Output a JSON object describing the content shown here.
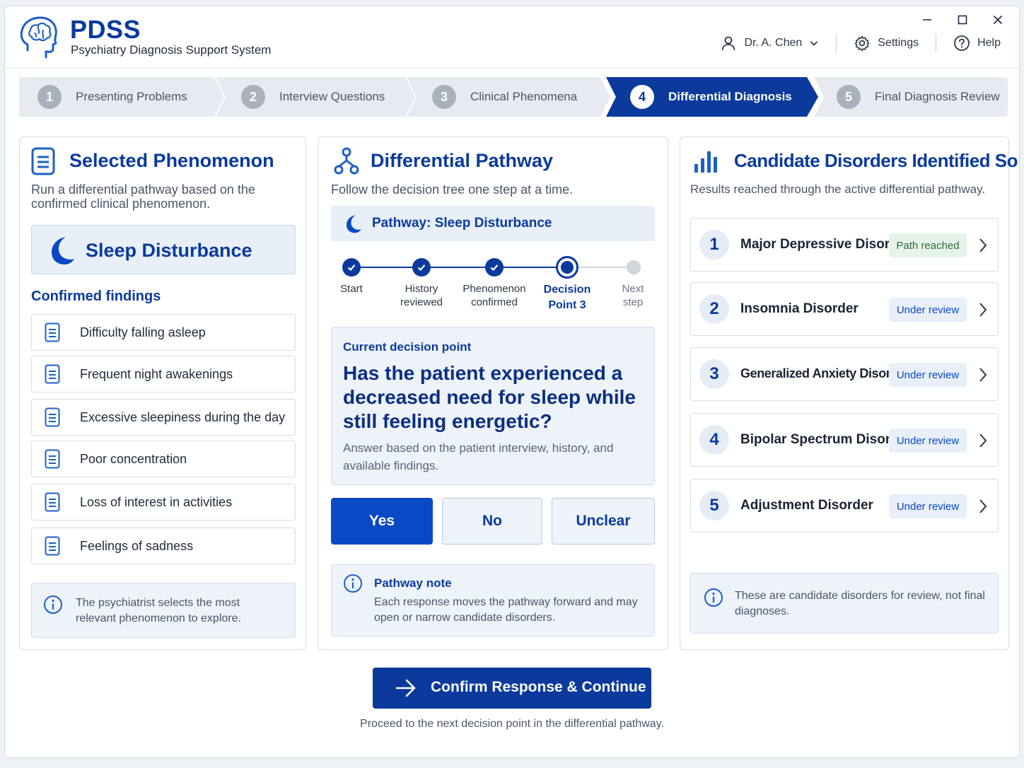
{
  "app": {
    "name": "PDSS",
    "subtitle": "Psychiatry Diagnosis Support System"
  },
  "window_controls": {
    "minimize": "−",
    "maximize": "▢",
    "close": "✕"
  },
  "user_bar": {
    "user": "Dr. A. Chen",
    "settings": "Settings",
    "help": "Help"
  },
  "steps": [
    {
      "num": "1",
      "label": "Presenting Problems",
      "active": false
    },
    {
      "num": "2",
      "label": "Interview Questions",
      "active": false
    },
    {
      "num": "3",
      "label": "Clinical Phenomena",
      "active": false
    },
    {
      "num": "4",
      "label": "Differential Diagnosis",
      "active": true
    },
    {
      "num": "5",
      "label": "Final Diagnosis Review",
      "active": false
    }
  ],
  "left": {
    "title": "Selected Phenomenon",
    "subtitle": "Run a differential pathway based on the confirmed clinical phenomenon.",
    "phenomenon": "Sleep Disturbance",
    "findings_title": "Confirmed findings",
    "findings": [
      "Difficulty falling asleep",
      "Frequent night awakenings",
      "Excessive sleepiness during the day",
      "Poor concentration",
      "Loss of interest in activities",
      "Feelings of sadness"
    ],
    "info": "The psychiatrist selects the most relevant phenomenon to explore."
  },
  "middle": {
    "title": "Differential Pathway",
    "subtitle": "Follow the decision tree one step at a time.",
    "pathway": "Pathway: Sleep Disturbance",
    "progress": {
      "start": "Start",
      "history_1": "History",
      "history_2": "reviewed",
      "phenomenon_1": "Phenomenon",
      "phenomenon_2": "confirmed",
      "decision_1": "Decision",
      "decision_2": "Point 3",
      "next_1": "Next",
      "next_2": "step"
    },
    "decision_label": "Current decision point",
    "question": "Has the patient experienced a decreased need for sleep while still feeling energetic?",
    "answer_hint": "Answer based on the patient interview, history, and available findings.",
    "answers": {
      "yes": "Yes",
      "no": "No",
      "unclear": "Unclear"
    },
    "note_title": "Pathway note",
    "note_text": "Each response moves the pathway forward and may open or narrow candidate disorders."
  },
  "right": {
    "title": "Candidate Disorders Identified So Far",
    "subtitle": "Results reached through the active differential pathway.",
    "candidates": [
      {
        "num": "1",
        "name": "Major Depressive Disorder",
        "status": "Path reached"
      },
      {
        "num": "2",
        "name": "Insomnia Disorder",
        "status": "Under review"
      },
      {
        "num": "3",
        "name": "Generalized Anxiety Disorder",
        "status": "Under review"
      },
      {
        "num": "4",
        "name": "Bipolar Spectrum Disorder",
        "status": "Under review"
      },
      {
        "num": "5",
        "name": "Adjustment Disorder",
        "status": "Under review"
      }
    ],
    "info": "These are candidate disorders for review, not final diagnoses."
  },
  "footer": {
    "confirm": "Confirm Response & Continue",
    "note": "Proceed to the next decision point in the differential pathway."
  },
  "colors": {
    "primary": "#0b3a9c",
    "accent": "#0b48c6",
    "success": "#2f6b3a"
  }
}
